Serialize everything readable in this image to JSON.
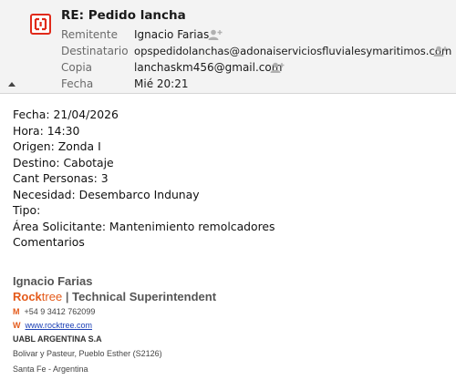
{
  "message": {
    "subject": "RE: Pedido lancha",
    "fields": [
      {
        "label": "Remitente",
        "value": "Ignacio Farias"
      },
      {
        "label": "Destinatario",
        "value": "opspedidolanchas@adonaiserviciosfluvialesymaritimos.com"
      },
      {
        "label": "Copia",
        "value": "lanchaskm456@gmail.com"
      },
      {
        "label": "Fecha",
        "value": "Mié 20:21"
      }
    ],
    "icons": {
      "logo": "app-logo-icon",
      "add_contact": "person-add-icon",
      "collapse": "collapse-triangle-icon"
    }
  },
  "body": {
    "lines": [
      "Fecha: 21/04/2026",
      "Hora: 14:30",
      "Origen: Zonda I",
      "Destino: Cabotaje",
      "Cant Personas: 3",
      "Necesidad: Desembarco Indunay",
      "Tipo:",
      "Área Solicitante: Mantenimiento remolcadores",
      "Comentarios"
    ]
  },
  "signature": {
    "name": "Ignacio Farias",
    "brand_primary": "Rock",
    "brand_secondary": "tree",
    "separator": "|",
    "role": "Technical Superintendent",
    "phone_letter": "M",
    "phone": "+54 9 3412 762099",
    "web_letter": "W",
    "web": "www.rocktree.com",
    "company": "UABL ARGENTINA S.A",
    "address": "Bolivar y Pasteur, Pueblo Esther (S2126)",
    "city": "Santa Fe - Argentina"
  },
  "colors": {
    "accent": "#e02a1a",
    "brand": "#e45a1a",
    "link": "#1a3fb5"
  }
}
